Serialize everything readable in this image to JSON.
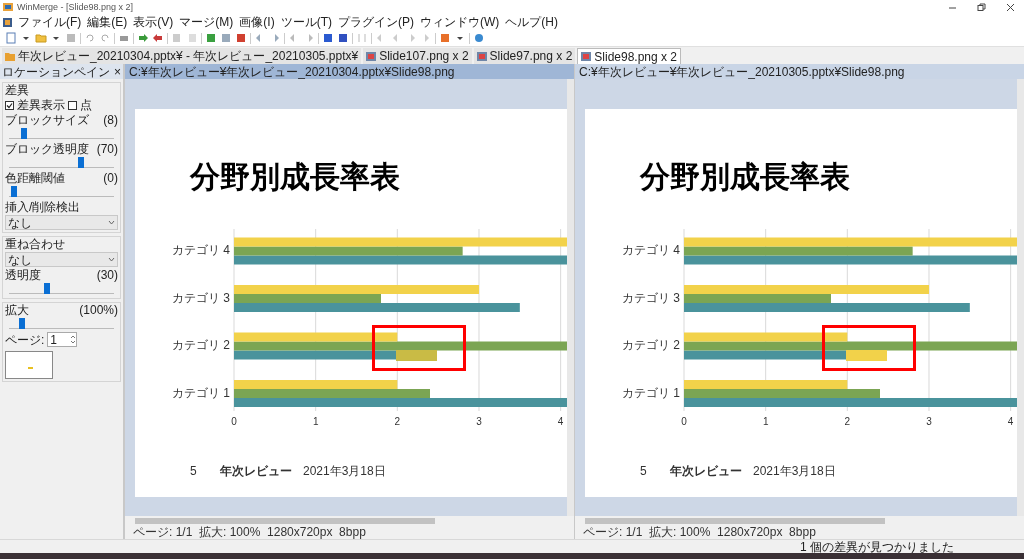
{
  "window": {
    "title": "WinMerge - [Slide98.png x 2]"
  },
  "menu": [
    "ファイル(F)",
    "編集(E)",
    "表示(V)",
    "マージ(M)",
    "画像(I)",
    "ツール(T)",
    "プラグイン(P)",
    "ウィンドウ(W)",
    "ヘルプ(H)"
  ],
  "tabs": [
    {
      "label": "年次レビュー_20210304.pptx¥ - 年次レビュー_20210305.pptx¥",
      "kind": "folder",
      "selected": false
    },
    {
      "label": "Slide107.png x 2",
      "kind": "image",
      "selected": false
    },
    {
      "label": "Slide97.png x 2",
      "kind": "image",
      "selected": false
    },
    {
      "label": "Slide98.png x 2",
      "kind": "image",
      "selected": true
    }
  ],
  "location_pane": {
    "title": "ロケーションペイン",
    "close": "×",
    "sections": [
      {
        "title": "差異",
        "items": [
          {
            "kind": "checks",
            "checks": [
              {
                "label": "差異表示",
                "checked": true
              },
              {
                "label": "点",
                "checked": false
              }
            ]
          },
          {
            "kind": "slider",
            "label": "ブロックサイズ",
            "reading": "(8)",
            "level": 0.12
          },
          {
            "kind": "slider",
            "label": "ブロック透明度",
            "reading": "(70)",
            "level": 0.7
          },
          {
            "kind": "slider",
            "label": "色距離閾値",
            "reading": "(0)",
            "level": 0.02
          },
          {
            "kind": "label",
            "label": "挿入/削除検出"
          },
          {
            "kind": "dropdown",
            "value": "なし"
          }
        ]
      },
      {
        "title": "重ね合わせ",
        "items": [
          {
            "kind": "dropdown",
            "value": "なし"
          },
          {
            "kind": "slider",
            "label": "透明度",
            "reading": "(30)",
            "level": 0.35
          }
        ]
      },
      {
        "items": [
          {
            "kind": "slider",
            "label": "拡大",
            "reading": "(100%)",
            "level": 0.1
          },
          {
            "kind": "spin",
            "label": "ページ:",
            "value": "1"
          },
          {
            "kind": "thumbnail"
          }
        ]
      }
    ]
  },
  "panes": [
    {
      "path": "C:¥年次レビュー¥年次レビュー_20210304.pptx¥Slide98.png",
      "selected": true,
      "slide": {
        "title": "分野別成長率表",
        "chart_data": {
          "type": "bar",
          "orientation": "horizontal",
          "categories": [
            "カテゴリ 4",
            "カテゴリ 3",
            "カテゴリ 2",
            "カテゴリ 1"
          ],
          "series": [
            {
              "color": "#4a939c",
              "values": [
                4.09,
                3.5,
                2,
                4.09
              ]
            },
            {
              "color": "#7ba553",
              "values": [
                2.8,
                1.8,
                4.09,
                2.4
              ]
            },
            {
              "color": "#f2d24a",
              "values": [
                4.09,
                3,
                2,
                2
              ]
            }
          ],
          "xlim": [
            0,
            4.09
          ],
          "xticks": [
            0,
            1,
            2,
            3,
            4
          ],
          "grid": true
        },
        "diff_highlight": {
          "kind": "blended"
        },
        "footer": {
          "page": "5",
          "name": "年次レビュー",
          "date": "2021年3月18日"
        }
      },
      "status": "ページ: 1/1  拡大: 100%  1280x720px  8bpp"
    },
    {
      "path": "C:¥年次レビュー¥年次レビュー_20210305.pptx¥Slide98.png",
      "selected": false,
      "slide": {
        "title": "分野別成長率表",
        "chart_data": {
          "type": "bar",
          "orientation": "horizontal",
          "categories": [
            "カテゴリ 4",
            "カテゴリ 3",
            "カテゴリ 2",
            "カテゴリ 1"
          ],
          "series": [
            {
              "color": "#4a939c",
              "values": [
                4.09,
                3.5,
                2,
                4.09
              ]
            },
            {
              "color": "#7ba553",
              "values": [
                2.8,
                1.8,
                4.09,
                2.4
              ]
            },
            {
              "color": "#f2d24a",
              "values": [
                4.09,
                3,
                2,
                2
              ]
            }
          ],
          "xlim": [
            0,
            4.09
          ],
          "xticks": [
            0,
            1,
            2,
            3,
            4
          ],
          "grid": true
        },
        "diff_highlight": {
          "kind": "solid"
        },
        "footer": {
          "page": "5",
          "name": "年次レビュー",
          "date": "2021年3月18日"
        }
      },
      "status": "ページ: 1/1  拡大: 100%  1280x720px  8bpp"
    }
  ],
  "status_bar": {
    "message": "1 個の差異が見つかりました"
  }
}
